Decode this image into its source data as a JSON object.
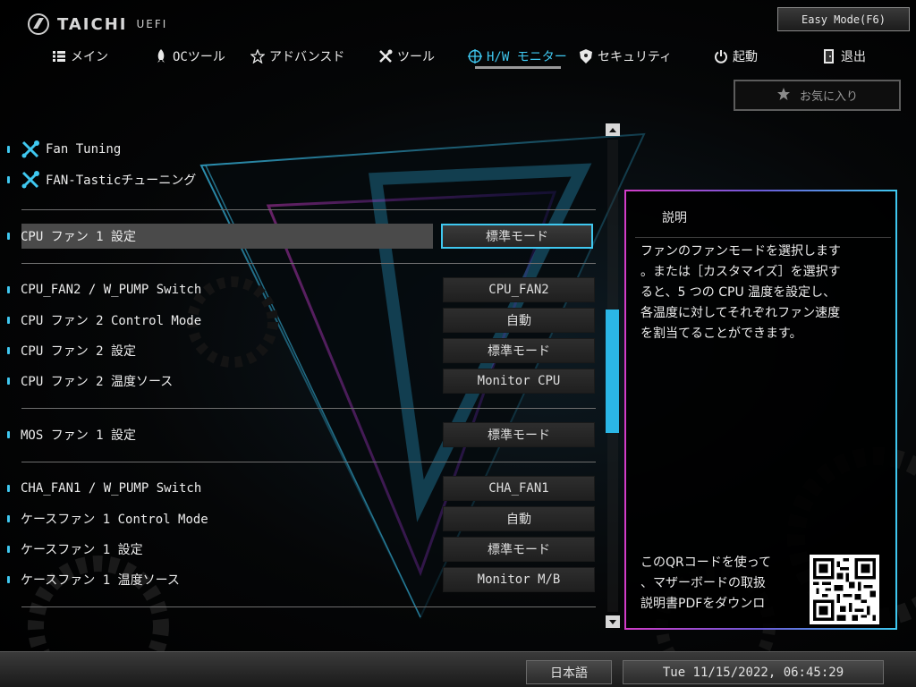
{
  "app": {
    "logo_text": "TAICHI",
    "logo_sub": "UEFI",
    "easy_mode_label": "Easy Mode(F6)"
  },
  "nav": {
    "items": [
      {
        "label": "メイン",
        "icon": "list-icon"
      },
      {
        "label": "OCツール",
        "icon": "rocket-icon"
      },
      {
        "label": "アドバンスド",
        "icon": "star-outline-icon"
      },
      {
        "label": "ツール",
        "icon": "tools-icon"
      },
      {
        "label": "H/W モニター",
        "icon": "monitor-target-icon",
        "active": true
      },
      {
        "label": "セキュリティ",
        "icon": "shield-icon"
      },
      {
        "label": "起動",
        "icon": "power-icon"
      },
      {
        "label": "退出",
        "icon": "exit-door-icon"
      }
    ],
    "active_color": "#3fc8f0"
  },
  "favorites": {
    "label": "お気に入り",
    "icon": "star-icon"
  },
  "settings": {
    "links": [
      {
        "label": "Fan Tuning",
        "icon": "tools-icon"
      },
      {
        "label": "FAN-Tasticチューニング",
        "icon": "tools-icon"
      }
    ],
    "rows": [
      {
        "label": "CPU ファン 1 設定",
        "value": "標準モード",
        "selected": true
      },
      {
        "label": "CPU_FAN2 / W_PUMP Switch",
        "value": "CPU_FAN2"
      },
      {
        "label": "CPU ファン 2 Control Mode",
        "value": "自動"
      },
      {
        "label": "CPU ファン 2 設定",
        "value": "標準モード"
      },
      {
        "label": "CPU ファン 2 温度ソース",
        "value": "Monitor CPU"
      },
      {
        "label": "MOS ファン 1 設定",
        "value": "標準モード"
      },
      {
        "label": "CHA_FAN1 / W_PUMP Switch",
        "value": "CHA_FAN1"
      },
      {
        "label": "ケースファン 1 Control Mode",
        "value": "自動"
      },
      {
        "label": "ケースファン 1 設定",
        "value": "標準モード"
      },
      {
        "label": "ケースファン 1 温度ソース",
        "value": "Monitor M/B"
      }
    ]
  },
  "description": {
    "title": "説明",
    "body": "ファンのファンモードを選択します\n。または［カスタマイズ］を選択す\nると、5 つの CPU 温度を設定し、\n各温度に対してそれぞれファン速度\nを割当てることができます。",
    "qr_text": "このQRコードを使って\n、マザーボードの取扱\n説明書PDFをダウンロ"
  },
  "footer": {
    "language": "日本語",
    "datetime": "Tue 11/15/2022, 06:45:29"
  },
  "colors": {
    "accent": "#3fc8f0",
    "panel_border_left": "#d23cc8",
    "panel_border_right": "#3fc8f0",
    "scroll_thumb": "#2bb6e6"
  }
}
